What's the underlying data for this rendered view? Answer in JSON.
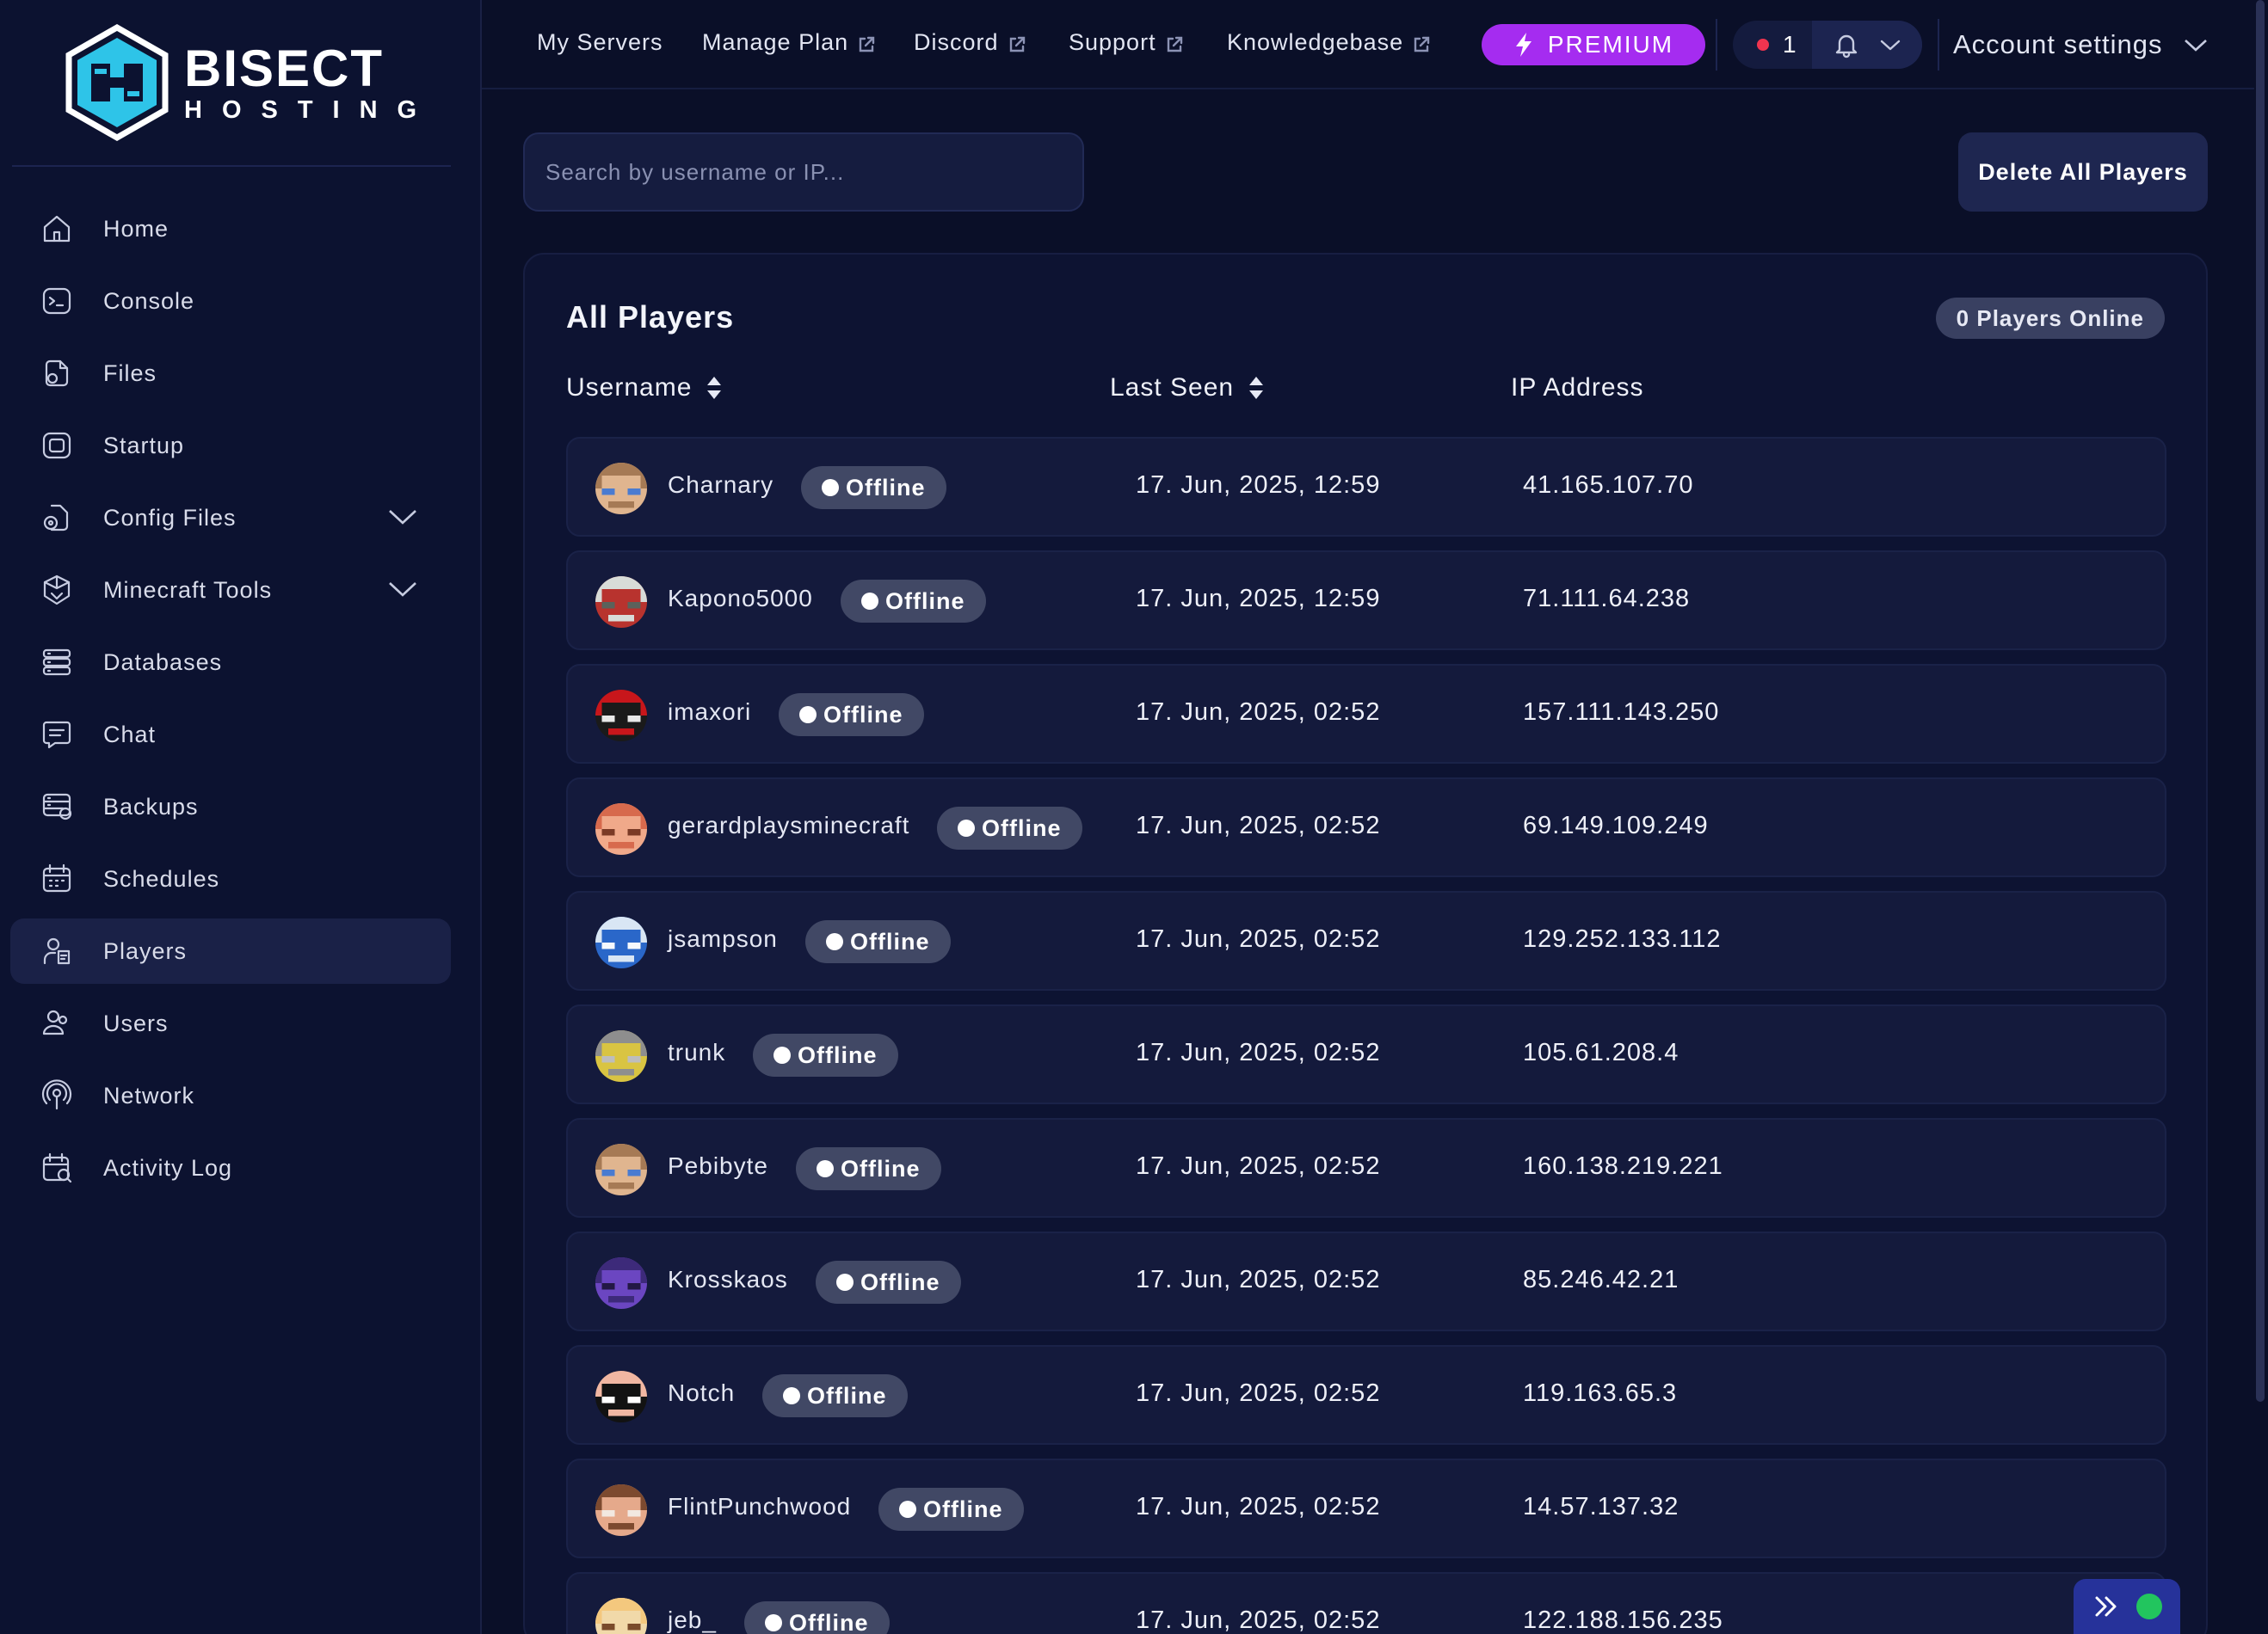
{
  "brand": {
    "name": "BISECT",
    "sub": "HOSTING"
  },
  "sidebar": {
    "items": [
      {
        "label": "Home",
        "icon": "home-icon",
        "name": "home"
      },
      {
        "label": "Console",
        "icon": "console-icon",
        "name": "console"
      },
      {
        "label": "Files",
        "icon": "files-icon",
        "name": "files"
      },
      {
        "label": "Startup",
        "icon": "startup-icon",
        "name": "startup"
      },
      {
        "label": "Config Files",
        "icon": "config-files-icon",
        "name": "config-files",
        "expandable": true
      },
      {
        "label": "Minecraft Tools",
        "icon": "minecraft-tools-icon",
        "name": "minecraft-tools",
        "expandable": true
      },
      {
        "label": "Databases",
        "icon": "databases-icon",
        "name": "databases"
      },
      {
        "label": "Chat",
        "icon": "chat-icon",
        "name": "chat"
      },
      {
        "label": "Backups",
        "icon": "backups-icon",
        "name": "backups"
      },
      {
        "label": "Schedules",
        "icon": "schedules-icon",
        "name": "schedules"
      },
      {
        "label": "Players",
        "icon": "players-icon",
        "name": "players",
        "active": true
      },
      {
        "label": "Users",
        "icon": "users-icon",
        "name": "users"
      },
      {
        "label": "Network",
        "icon": "network-icon",
        "name": "network"
      },
      {
        "label": "Activity Log",
        "icon": "activity-log-icon",
        "name": "activity-log"
      }
    ]
  },
  "topbar": {
    "links": [
      {
        "label": "My Servers",
        "external": false
      },
      {
        "label": "Manage Plan",
        "external": true
      },
      {
        "label": "Discord",
        "external": true
      },
      {
        "label": "Support",
        "external": true
      },
      {
        "label": "Knowledgebase",
        "external": true
      }
    ],
    "premium_label": "PREMIUM",
    "notification_count": "1",
    "account_label": "Account settings"
  },
  "search": {
    "placeholder": "Search by username or IP..."
  },
  "delete_all_label": "Delete All Players",
  "panel": {
    "title": "All Players",
    "online_badge": "0 Players Online",
    "columns": {
      "username": "Username",
      "last_seen": "Last Seen",
      "ip": "IP Address"
    }
  },
  "players": [
    {
      "username": "Charnary",
      "status": "Offline",
      "last_seen": "17. Jun, 2025, 12:59",
      "ip": "41.165.107.70",
      "colors": [
        "#a67a55",
        "#e0b58f",
        "#4a7bd0"
      ]
    },
    {
      "username": "Kapono5000",
      "status": "Offline",
      "last_seen": "17. Jun, 2025, 12:59",
      "ip": "71.111.64.238",
      "colors": [
        "#d8dcd8",
        "#b8332e",
        "#5b625b"
      ]
    },
    {
      "username": "imaxori",
      "status": "Offline",
      "last_seen": "17. Jun, 2025, 02:52",
      "ip": "157.111.143.250",
      "colors": [
        "#c8161b",
        "#1a1a1a",
        "#e8e8e8"
      ]
    },
    {
      "username": "gerardplaysminecraft",
      "status": "Offline",
      "last_seen": "17. Jun, 2025, 02:52",
      "ip": "69.149.109.249",
      "colors": [
        "#d76a4d",
        "#f0a98a",
        "#7b3a25"
      ]
    },
    {
      "username": "jsampson",
      "status": "Offline",
      "last_seen": "17. Jun, 2025, 02:52",
      "ip": "129.252.133.112",
      "colors": [
        "#d9e6f4",
        "#2a67c9",
        "#f5f8fc"
      ]
    },
    {
      "username": "trunk",
      "status": "Offline",
      "last_seen": "17. Jun, 2025, 02:52",
      "ip": "105.61.208.4",
      "colors": [
        "#8e8e8e",
        "#d9c442",
        "#bdbdbd"
      ]
    },
    {
      "username": "Pebibyte",
      "status": "Offline",
      "last_seen": "17. Jun, 2025, 02:52",
      "ip": "160.138.219.221",
      "colors": [
        "#a67a55",
        "#e0b58f",
        "#4a7bd0"
      ]
    },
    {
      "username": "Krosskaos",
      "status": "Offline",
      "last_seen": "17. Jun, 2025, 02:52",
      "ip": "85.246.42.21",
      "colors": [
        "#3d2a7a",
        "#6b46c1",
        "#231845"
      ]
    },
    {
      "username": "Notch",
      "status": "Offline",
      "last_seen": "17. Jun, 2025, 02:52",
      "ip": "119.163.65.3",
      "colors": [
        "#f1b7a2",
        "#121212",
        "#ffffff"
      ]
    },
    {
      "username": "FlintPunchwood",
      "status": "Offline",
      "last_seen": "17. Jun, 2025, 02:52",
      "ip": "14.57.137.32",
      "colors": [
        "#7d4a2f",
        "#e5a98b",
        "#f2e8e0"
      ]
    },
    {
      "username": "jeb_",
      "status": "Offline",
      "last_seen": "17. Jun, 2025, 02:52",
      "ip": "122.188.156.235",
      "colors": [
        "#f4c87e",
        "#f1d9a9",
        "#7a4b2b"
      ]
    }
  ]
}
